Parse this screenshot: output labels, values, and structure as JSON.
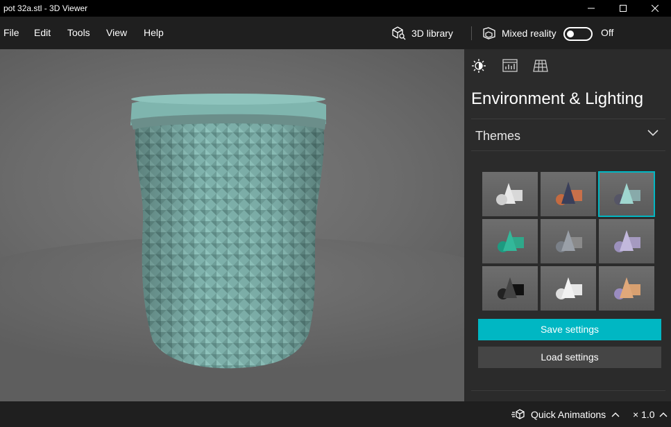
{
  "window": {
    "title": "pot 32a.stl - 3D Viewer"
  },
  "menu": {
    "file": "File",
    "edit": "Edit",
    "tools": "Tools",
    "view": "View",
    "help": "Help"
  },
  "toolbar": {
    "library_label": "3D library",
    "mixed_reality_label": "Mixed reality",
    "mixed_reality_state": "Off"
  },
  "panel": {
    "title": "Environment & Lighting",
    "themes_label": "Themes",
    "selected_theme": 3,
    "save_label": "Save settings",
    "load_label": "Load settings"
  },
  "statusbar": {
    "animations_label": "Quick Animations",
    "speed_label": "× 1.0"
  },
  "colors": {
    "accent": "#00b7c3",
    "model": "#7fb5ae"
  }
}
